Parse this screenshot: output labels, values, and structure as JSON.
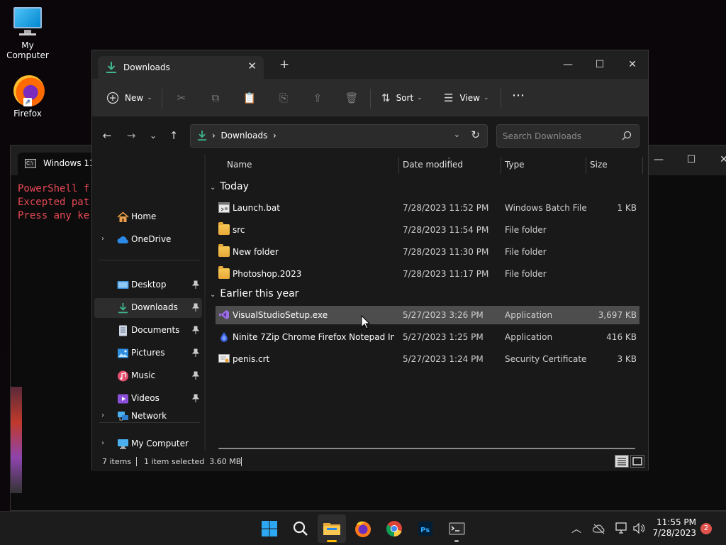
{
  "desktop": {
    "icons": [
      {
        "label": "My Computer"
      },
      {
        "label": "Firefox"
      }
    ]
  },
  "powershell": {
    "tab_label": "Windows 11 I",
    "lines": [
      "PowerShell f",
      "Excepted pat",
      "Press any ke"
    ]
  },
  "explorer": {
    "tab": {
      "label": "Downloads"
    },
    "commands": {
      "new": "New",
      "sort": "Sort",
      "view": "View"
    },
    "address": {
      "path": [
        "Downloads"
      ]
    },
    "search": {
      "placeholder": "Search Downloads"
    },
    "sidebar": [
      {
        "label": "Home",
        "icon": "home-icon"
      },
      {
        "label": "OneDrive",
        "icon": "cloud-icon",
        "expandable": true
      },
      {
        "label": "Desktop",
        "icon": "desktop-icon",
        "pinned": true
      },
      {
        "label": "Downloads",
        "icon": "download-icon",
        "pinned": true,
        "selected": true
      },
      {
        "label": "Documents",
        "icon": "document-icon",
        "pinned": true
      },
      {
        "label": "Pictures",
        "icon": "pictures-icon",
        "pinned": true
      },
      {
        "label": "Music",
        "icon": "music-icon",
        "pinned": true
      },
      {
        "label": "Videos",
        "icon": "video-icon",
        "pinned": true
      },
      {
        "label": "My Computer",
        "icon": "computer-icon",
        "expandable": true
      },
      {
        "label": "Network",
        "icon": "network-icon",
        "expandable": true
      }
    ],
    "columns": {
      "name": "Name",
      "date": "Date modified",
      "type": "Type",
      "size": "Size"
    },
    "groups": [
      {
        "label": "Today",
        "files": [
          {
            "name": "Launch.bat",
            "date": "7/28/2023 11:52 PM",
            "type": "Windows Batch File",
            "size": "1 KB",
            "icon": "batch-file-icon"
          },
          {
            "name": "src",
            "date": "7/28/2023 11:54 PM",
            "type": "File folder",
            "size": "",
            "icon": "folder-icon"
          },
          {
            "name": "New folder",
            "date": "7/28/2023 11:30 PM",
            "type": "File folder",
            "size": "",
            "icon": "folder-icon"
          },
          {
            "name": "Photoshop.2023",
            "date": "7/28/2023 11:17 PM",
            "type": "File folder",
            "size": "",
            "icon": "folder-icon"
          }
        ]
      },
      {
        "label": "Earlier this year",
        "files": [
          {
            "name": "VisualStudioSetup.exe",
            "date": "5/27/2023 3:26 PM",
            "type": "Application",
            "size": "3,697 KB",
            "icon": "visual-studio-icon",
            "selected": true
          },
          {
            "name": "Ninite 7Zip Chrome Firefox Notepad Inst...",
            "date": "5/27/2023 1:25 PM",
            "type": "Application",
            "size": "416 KB",
            "icon": "ninite-icon"
          },
          {
            "name": "penis.crt",
            "date": "5/27/2023 1:24 PM",
            "type": "Security Certificate",
            "size": "3 KB",
            "icon": "certificate-icon"
          }
        ]
      }
    ],
    "status": {
      "count": "7 items",
      "selection": "1 item selected  3.60 MB"
    }
  },
  "taskbar": {
    "clock": {
      "time": "11:55 PM",
      "date": "7/28/2023"
    },
    "notifications": "2"
  },
  "colors": {
    "accent": "#0078d4",
    "download_green": "#3fb68b",
    "folder": "#f4c14a"
  }
}
